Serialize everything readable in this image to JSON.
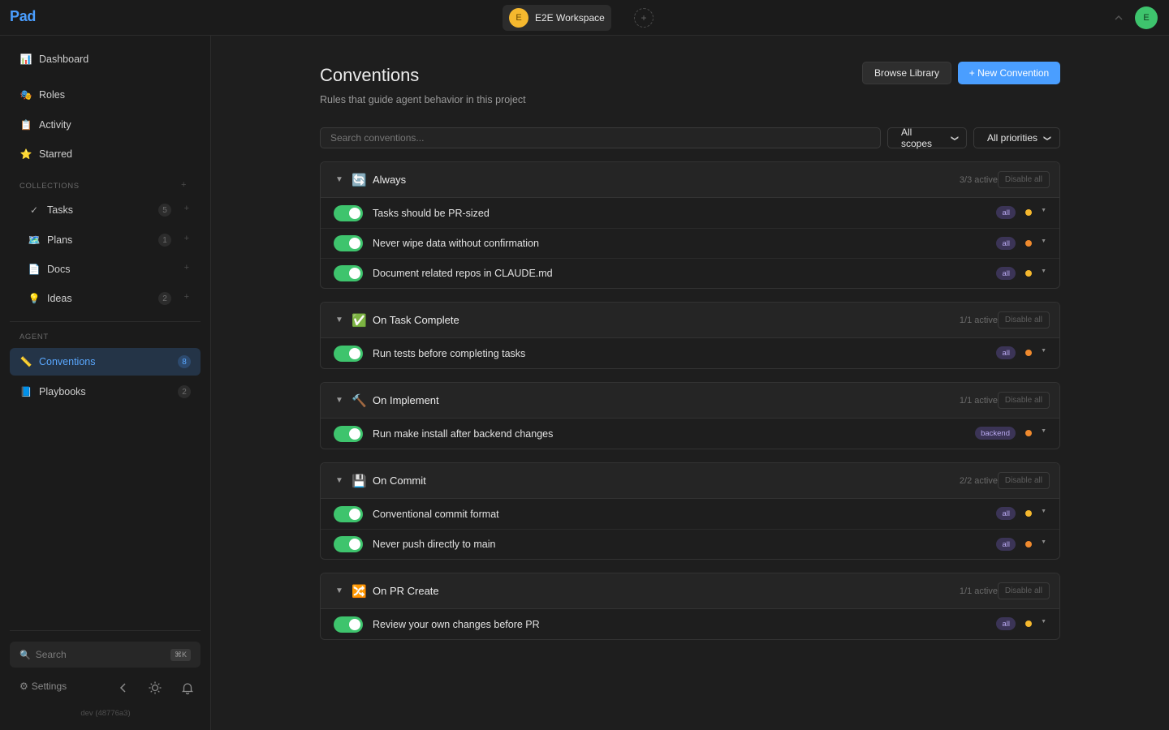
{
  "app": {
    "logo": "Pad"
  },
  "topbar": {
    "workspace_initial": "E",
    "workspace_name": "E2E Workspace",
    "add_workspace": "+",
    "user_initial": "E"
  },
  "sidebar": {
    "top_items": [
      {
        "label": "Dashboard",
        "icon": "📊"
      },
      {
        "label": "Roles",
        "icon": "🎭"
      },
      {
        "label": "Activity",
        "icon": "📋"
      },
      {
        "label": "Starred",
        "icon": "⭐"
      }
    ],
    "collections_label": "COLLECTIONS",
    "collections": [
      {
        "label": "Tasks",
        "icon": "✓",
        "count": "5"
      },
      {
        "label": "Plans",
        "icon": "🗺️",
        "count": "1"
      },
      {
        "label": "Docs",
        "icon": "📄",
        "count": ""
      },
      {
        "label": "Ideas",
        "icon": "💡",
        "count": "2"
      }
    ],
    "agent_label": "AGENT",
    "agent_items": [
      {
        "label": "Conventions",
        "icon": "📏",
        "count": "8",
        "active": true
      },
      {
        "label": "Playbooks",
        "icon": "📘",
        "count": "2"
      }
    ],
    "search_label": "Search",
    "search_shortcut": "⌘K",
    "settings_label": "Settings",
    "version": "dev (48776a3)"
  },
  "main": {
    "title": "Conventions",
    "subtitle": "Rules that guide agent behavior in this project",
    "browse_label": "Browse Library",
    "new_label": "+ New Convention",
    "search_placeholder": "Search conventions...",
    "scope_select": "All scopes",
    "priority_select": "All priorities",
    "disable_all_label": "Disable all",
    "groups": [
      {
        "name": "Always",
        "icon": "🔄",
        "active": "3/3 active",
        "rules": [
          {
            "name": "Tasks should be PR-sized",
            "scope": "all",
            "priority_color": "#f5b82e"
          },
          {
            "name": "Never wipe data without confirmation",
            "scope": "all",
            "priority_color": "#f08a2e"
          },
          {
            "name": "Document related repos in CLAUDE.md",
            "scope": "all",
            "priority_color": "#f5b82e"
          }
        ]
      },
      {
        "name": "On Task Complete",
        "icon": "✅",
        "active": "1/1 active",
        "rules": [
          {
            "name": "Run tests before completing tasks",
            "scope": "all",
            "priority_color": "#f08a2e"
          }
        ]
      },
      {
        "name": "On Implement",
        "icon": "🔨",
        "active": "1/1 active",
        "rules": [
          {
            "name": "Run make install after backend changes",
            "scope": "backend",
            "priority_color": "#f08a2e"
          }
        ]
      },
      {
        "name": "On Commit",
        "icon": "💾",
        "active": "2/2 active",
        "rules": [
          {
            "name": "Conventional commit format",
            "scope": "all",
            "priority_color": "#f5b82e"
          },
          {
            "name": "Never push directly to main",
            "scope": "all",
            "priority_color": "#f08a2e"
          }
        ]
      },
      {
        "name": "On PR Create",
        "icon": "🔀",
        "active": "1/1 active",
        "rules": [
          {
            "name": "Review your own changes before PR",
            "scope": "all",
            "priority_color": "#f5b82e"
          }
        ]
      }
    ]
  }
}
